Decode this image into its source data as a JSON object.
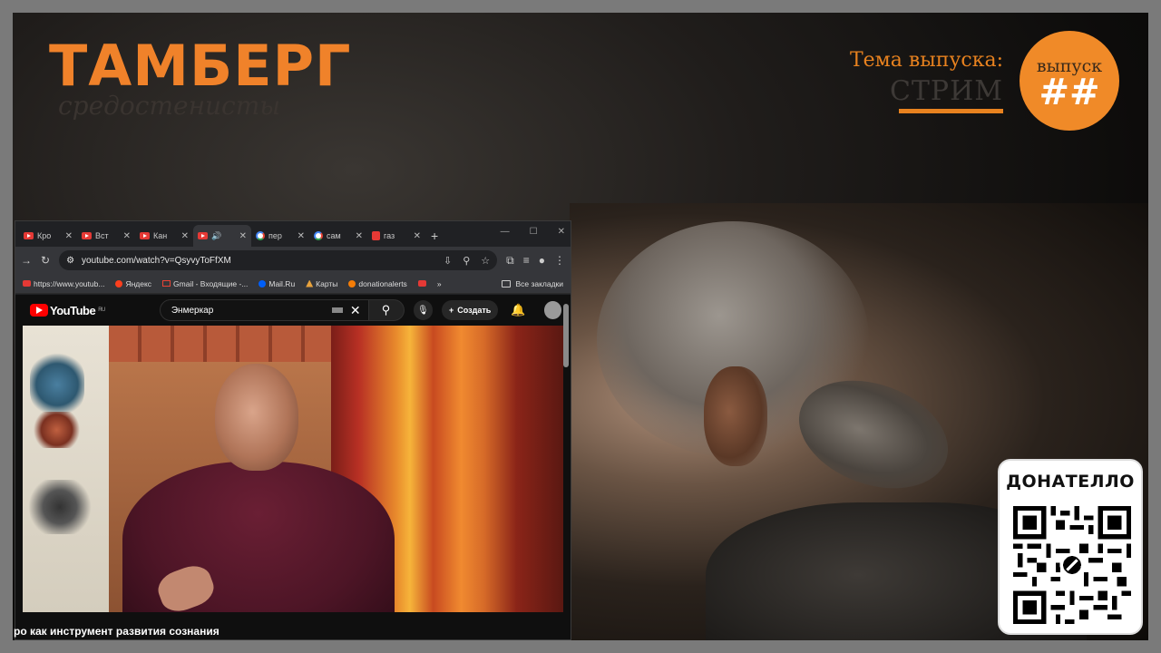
{
  "logo": {
    "title": "ТАМБЕРГ",
    "subtitle": "средостенисты"
  },
  "topic": {
    "label": "Тема выпуска:",
    "value": "СТРИМ"
  },
  "episode": {
    "label": "выпуск",
    "number": "##"
  },
  "donate": {
    "title": "ДОНАТЕЛЛО"
  },
  "browser": {
    "tabs": [
      {
        "label": "Кро",
        "icon": "youtube-icon"
      },
      {
        "label": "Вст",
        "icon": "youtube-icon"
      },
      {
        "label": "Кан",
        "icon": "youtube-icon"
      },
      {
        "label": "",
        "icon": "youtube-icon",
        "active": true
      },
      {
        "label": "пер",
        "icon": "google-icon"
      },
      {
        "label": "сам",
        "icon": "google-icon"
      },
      {
        "label": "газ",
        "icon": "zen-icon"
      }
    ],
    "address": "youtube.com/watch?v=QsyvyToFfXM",
    "bookmarks": [
      {
        "label": "https://www.youtub...",
        "icon": "youtube-icon"
      },
      {
        "label": "Яндекс",
        "icon": "yandex-icon"
      },
      {
        "label": "Gmail - Входящие -...",
        "icon": "gmail-icon"
      },
      {
        "label": "Mail.Ru",
        "icon": "mailru-icon"
      },
      {
        "label": "Карты",
        "icon": "maps-icon"
      },
      {
        "label": "donationalerts",
        "icon": "donationalerts-icon"
      },
      {
        "label": "",
        "icon": "youtube-icon"
      }
    ],
    "all_bookmarks": "Все закладки"
  },
  "youtube": {
    "logo_text": "YouTube",
    "region": "RU",
    "search_value": "Энмеркар",
    "create_label": "Создать",
    "caption": "ро как инструмент развития сознания"
  }
}
